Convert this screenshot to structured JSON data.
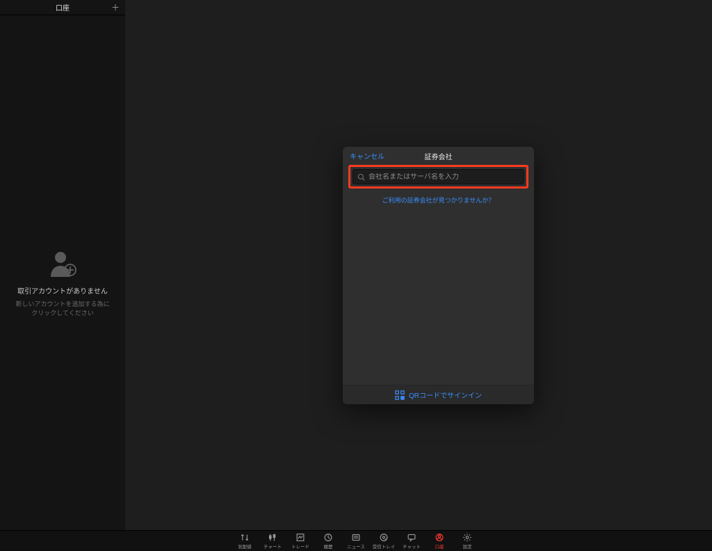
{
  "sidebar": {
    "title": "口座",
    "empty": {
      "line1": "取引アカウントがありません",
      "line2a": "新しいアカウントを追加する為に",
      "line2b": "クリックしてください"
    }
  },
  "modal": {
    "cancel": "キャンセル",
    "title": "証券会社",
    "search_placeholder": "会社名またはサーバ名を入力",
    "not_found_link": "ご利用の証券会社が見つかりませんか？",
    "qr_signin": "QRコードでサインイン"
  },
  "tabs": {
    "quotes": "気配値",
    "chart": "チャート",
    "trade": "トレード",
    "history": "履歴",
    "news": "ニュース",
    "inbox": "受信トレイ",
    "chat": "チャット",
    "account": "口座",
    "settings": "設定"
  },
  "colors": {
    "accent_blue": "#3a8fff",
    "accent_red": "#ff3b30",
    "highlight_border": "#ff3b1f"
  }
}
